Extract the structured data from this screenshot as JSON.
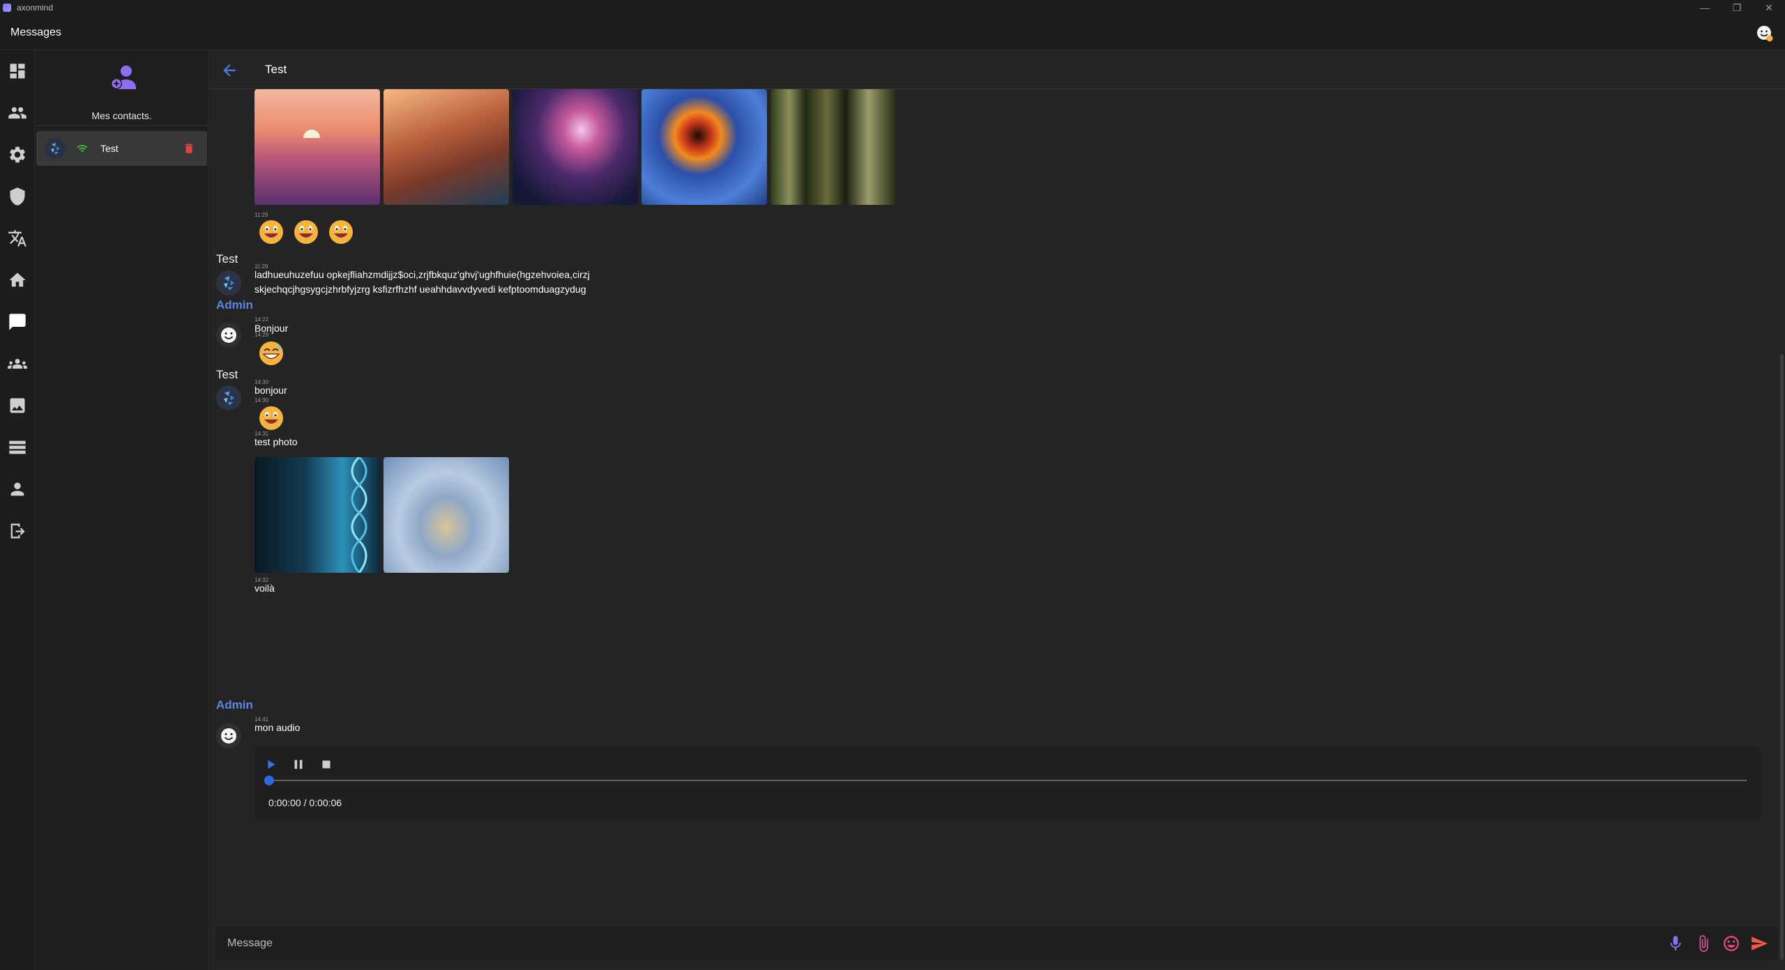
{
  "window": {
    "app_title": "axonmind",
    "minimize": "—",
    "maximize": "❐",
    "close": "✕"
  },
  "appbar": {
    "title": "Messages"
  },
  "rail": {
    "items": [
      "dashboard-icon",
      "contacts-icon",
      "settings-icon",
      "shield-icon",
      "translate-icon",
      "home-icon",
      "chat-icon",
      "groups-icon",
      "gallery-icon",
      "storage-icon",
      "profile-icon",
      "logout-icon"
    ],
    "active": "chat-icon"
  },
  "contacts": {
    "title": "Mes contacts.",
    "items": [
      {
        "name": "Test",
        "status": "online"
      }
    ]
  },
  "chat": {
    "title": "Test",
    "messages": {
      "g1": {
        "time": "11:29"
      },
      "g2": {
        "sender": "Test",
        "time": "11:29",
        "text_line1": "ladhueuhuzefuu opkejfliahzmdijjz$oci,zrjfbkquz'ghvj'ughfhuie(hgzehvoiea,cirzj",
        "text_line2": "skjechqcjhgsygcjzhrbfyjzrg ksfizrfhzhf ueahhdavvdyvedi kefptoomduagzydug"
      },
      "g3": {
        "sender": "Admin",
        "time1": "14:22",
        "text1": "Bonjour",
        "time2": "14:29"
      },
      "g4": {
        "sender": "Test",
        "time1": "14:30",
        "text1": "bonjour",
        "time2": "14:30",
        "time3": "14:31",
        "text3": "test photo",
        "time4": "14:32",
        "text4": "voilà"
      },
      "g5": {
        "sender": "Admin",
        "time1": "14:41",
        "text1": "mon audio",
        "audio_time": "0:00:00 / 0:00:06",
        "audio_progress": 0
      }
    },
    "composer": {
      "placeholder": "Message"
    }
  },
  "colors": {
    "accent": "#5a86e8",
    "purple": "#8f6df2",
    "delete": "#e0453a",
    "online": "#3cc13b"
  }
}
